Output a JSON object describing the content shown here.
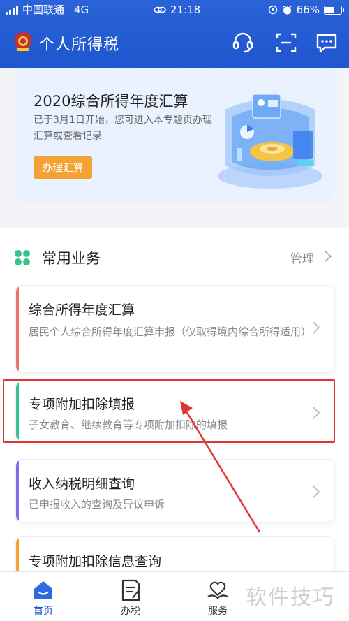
{
  "status_bar": {
    "carrier": "中国联通",
    "network": "4G",
    "time": "21:18",
    "battery_text": "66%",
    "battery_level": 0.66
  },
  "header": {
    "title": "个人所得税",
    "icons": [
      "customer-service-icon",
      "scan-icon",
      "message-icon"
    ]
  },
  "banner": {
    "title": "2020综合所得年度汇算",
    "description": "已于3月1日开始，您可进入本专题页办理汇算或查看记录",
    "button_label": "办理汇算"
  },
  "section": {
    "title": "常用业务",
    "manage_label": "管理"
  },
  "services": [
    {
      "title": "综合所得年度汇算",
      "description": "居民个人综合所得年度汇算申报（仅取得境内综合所得适用）",
      "accent": "#f0736a"
    },
    {
      "title": "专项附加扣除填报",
      "description": "子女教育、继续教育等专项附加扣除的填报",
      "accent": "#35c48a"
    },
    {
      "title": "收入纳税明细查询",
      "description": "已申报收入的查询及异议申诉",
      "accent": "#7b6cf0"
    },
    {
      "title": "专项附加扣除信息查询",
      "description": "",
      "accent": "#f3a233"
    }
  ],
  "bottom_nav": [
    {
      "label": "首页",
      "icon": "home-icon",
      "active": true
    },
    {
      "label": "办税",
      "icon": "tax-doc-icon",
      "active": false
    },
    {
      "label": "服务",
      "icon": "heart-hand-icon",
      "active": false
    }
  ],
  "watermark": "软件技巧",
  "colors": {
    "primary": "#1f56cf",
    "banner_bg": "#e9f2fe",
    "button_orange": "#f3a233",
    "highlight_red": "#e03636"
  }
}
